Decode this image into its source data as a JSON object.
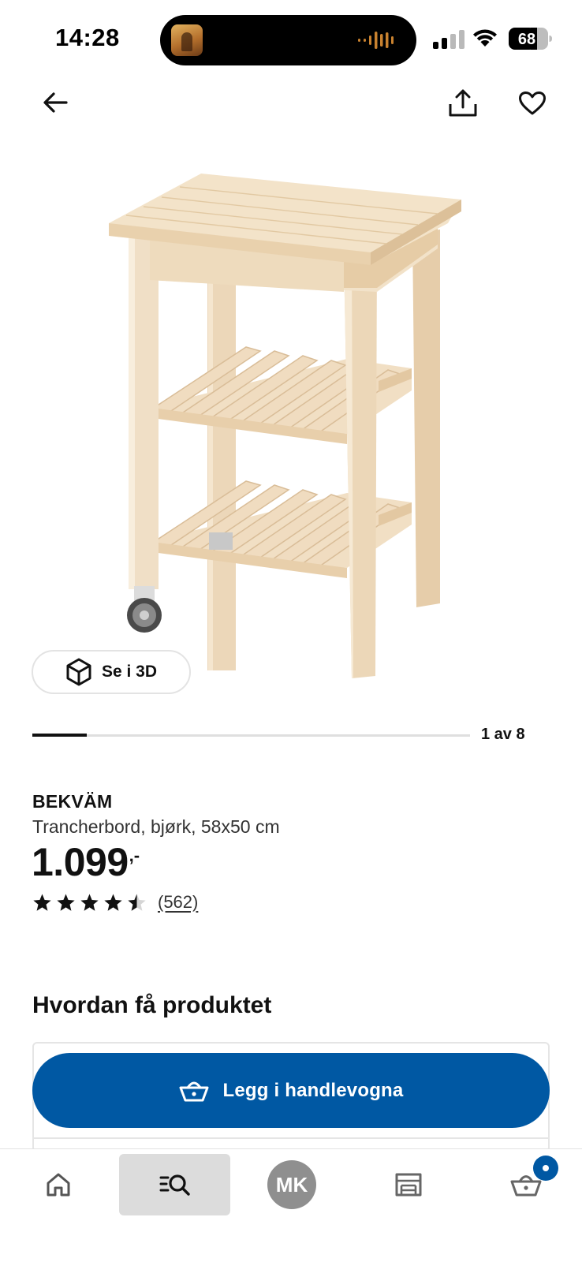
{
  "status_bar": {
    "time": "14:28",
    "battery": "68"
  },
  "top_nav": {
    "back_icon": "arrow-left-icon",
    "share_icon": "share-icon",
    "favorite_icon": "heart-icon"
  },
  "gallery": {
    "view_3d_label": "Se i 3D",
    "counter": "1 av 8",
    "current": 1,
    "total": 8
  },
  "product": {
    "name": "BEKVÄM",
    "description": "Trancherbord, bjørk, 58x50 cm",
    "price": "1.099",
    "price_suffix": ",-",
    "rating": 4.5,
    "rating_max": 5,
    "review_count": "(562)"
  },
  "delivery": {
    "title": "Hvordan få produktet",
    "add_to_cart_label": "Legg i handlevogna"
  },
  "bottom_nav": {
    "items": [
      {
        "icon": "home-icon"
      },
      {
        "icon": "search-list-icon"
      },
      {
        "label": "MK"
      },
      {
        "icon": "store-icon"
      },
      {
        "icon": "basket-icon"
      }
    ]
  },
  "colors": {
    "brand_blue": "#0058a3",
    "nav_selected": "#dcdcdc",
    "avatar_gray": "#8f8f8f"
  }
}
